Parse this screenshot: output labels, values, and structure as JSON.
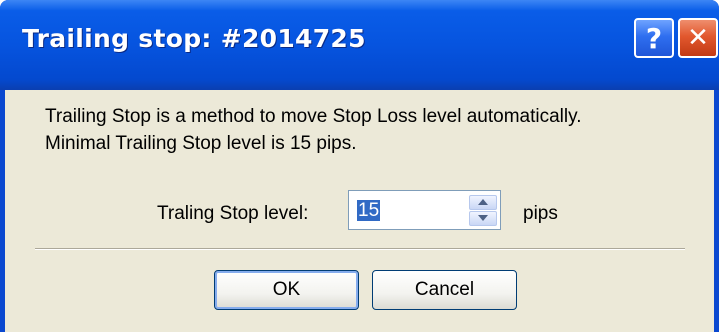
{
  "window": {
    "title": "Trailing stop:  #2014725",
    "help_glyph": "?",
    "close_glyph": "✕"
  },
  "description": {
    "line1": "Trailing Stop is a method to move Stop Loss level automatically.",
    "line2": "Minimal Trailing Stop level is 15 pips."
  },
  "trailing_level": {
    "label": "Traling Stop level:",
    "value": "15",
    "unit": "pips"
  },
  "buttons": {
    "ok": "OK",
    "cancel": "Cancel"
  },
  "colors": {
    "titlebar": "#0654df",
    "dialog_bg": "#ece9d8",
    "selection": "#316ac5",
    "close_button": "#e2582e",
    "help_button": "#2f6ff0"
  },
  "icons": [
    "help-icon",
    "close-icon",
    "spin-up-icon",
    "spin-down-icon"
  ]
}
